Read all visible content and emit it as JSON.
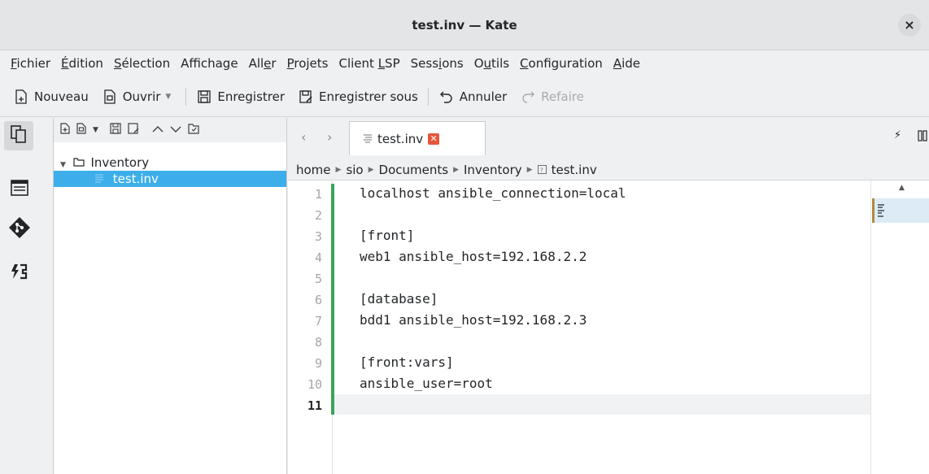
{
  "window": {
    "title": "test.inv — Kate",
    "close_glyph": "×"
  },
  "menu": [
    {
      "pre": "",
      "u": "F",
      "post": "ichier"
    },
    {
      "pre": "",
      "u": "É",
      "post": "dition"
    },
    {
      "pre": "",
      "u": "S",
      "post": "élection"
    },
    {
      "pre": "Afficha",
      "u": "g",
      "post": "e"
    },
    {
      "pre": "All",
      "u": "e",
      "post": "r"
    },
    {
      "pre": "",
      "u": "P",
      "post": "rojets"
    },
    {
      "pre": "Client ",
      "u": "L",
      "post": "SP"
    },
    {
      "pre": "Sess",
      "u": "i",
      "post": "ons"
    },
    {
      "pre": "O",
      "u": "u",
      "post": "tils"
    },
    {
      "pre": "",
      "u": "C",
      "post": "onfiguration"
    },
    {
      "pre": "",
      "u": "A",
      "post": "ide"
    }
  ],
  "toolbar": {
    "new_label": "Nouveau",
    "open_label": "Ouvrir",
    "save_label": "Enregistrer",
    "save_as_label": "Enregistrer sous",
    "undo_label": "Annuler",
    "redo_label": "Refaire"
  },
  "project": {
    "folder": "Inventory",
    "file": "test.inv"
  },
  "tab": {
    "label": "test.inv"
  },
  "breadcrumb": [
    "home",
    "sio",
    "Documents",
    "Inventory",
    "test.inv"
  ],
  "editor": {
    "line_numbers": [
      "1",
      "2",
      "3",
      "4",
      "5",
      "6",
      "7",
      "8",
      "9",
      "10",
      "11"
    ],
    "current_line": 11,
    "lines": [
      "localhost ansible_connection=local",
      "",
      "[front]",
      "web1 ansible_host=192.168.2.2",
      "",
      "[database]",
      "bdd1 ansible_host=192.168.2.3",
      "",
      "[front:vars]",
      "ansible_user=root",
      ""
    ]
  },
  "colors": {
    "selection": "#3daee9",
    "modified_line_marker": "#3aa55b",
    "tab_close": "#e5553c"
  }
}
